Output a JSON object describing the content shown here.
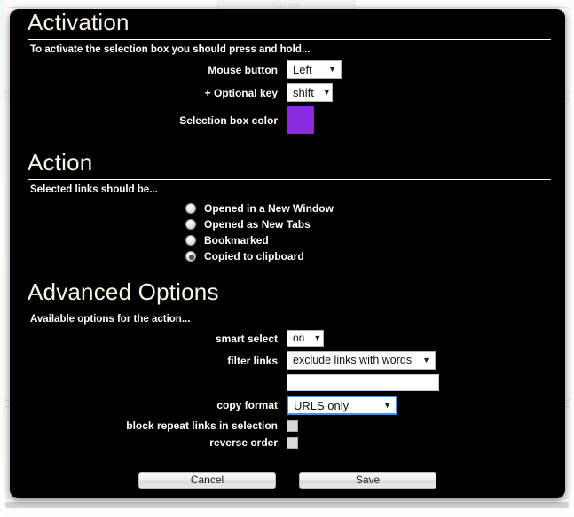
{
  "background": {
    "tab_label": "Guide"
  },
  "colors": {
    "selection_box": "#8a2be2",
    "modal_bg": "#000000",
    "heading": "#f7f4e8",
    "focus_border": "#4a8fe0"
  },
  "sections": {
    "activation": {
      "title": "Activation",
      "subtitle": "To activate the selection box you should press and hold...",
      "fields": {
        "mouse_button": {
          "label": "Mouse button",
          "value": "Left"
        },
        "optional_key": {
          "label": "+ Optional key",
          "value": "shift"
        },
        "selection_box_color": {
          "label": "Selection box color",
          "value": "#8a2be2"
        }
      }
    },
    "action": {
      "title": "Action",
      "subtitle": "Selected links should be...",
      "options": [
        {
          "label": "Opened in a New Window",
          "checked": false
        },
        {
          "label": "Opened as New Tabs",
          "checked": false
        },
        {
          "label": "Bookmarked",
          "checked": false
        },
        {
          "label": "Copied to clipboard",
          "checked": true
        }
      ]
    },
    "advanced": {
      "title": "Advanced Options",
      "subtitle": "Available options for the action...",
      "fields": {
        "smart_select": {
          "label": "smart select",
          "value": "on"
        },
        "filter_links": {
          "label": "filter links",
          "value": "exclude links with words",
          "text_value": "",
          "text_placeholder": ""
        },
        "copy_format": {
          "label": "copy format",
          "value": "URLS only"
        },
        "block_repeat": {
          "label": "block repeat links in selection",
          "checked": false
        },
        "reverse_order": {
          "label": "reverse order",
          "checked": false
        }
      }
    }
  },
  "footer": {
    "cancel_label": "Cancel",
    "save_label": "Save"
  },
  "icons": {
    "chevron_down": "▼"
  }
}
